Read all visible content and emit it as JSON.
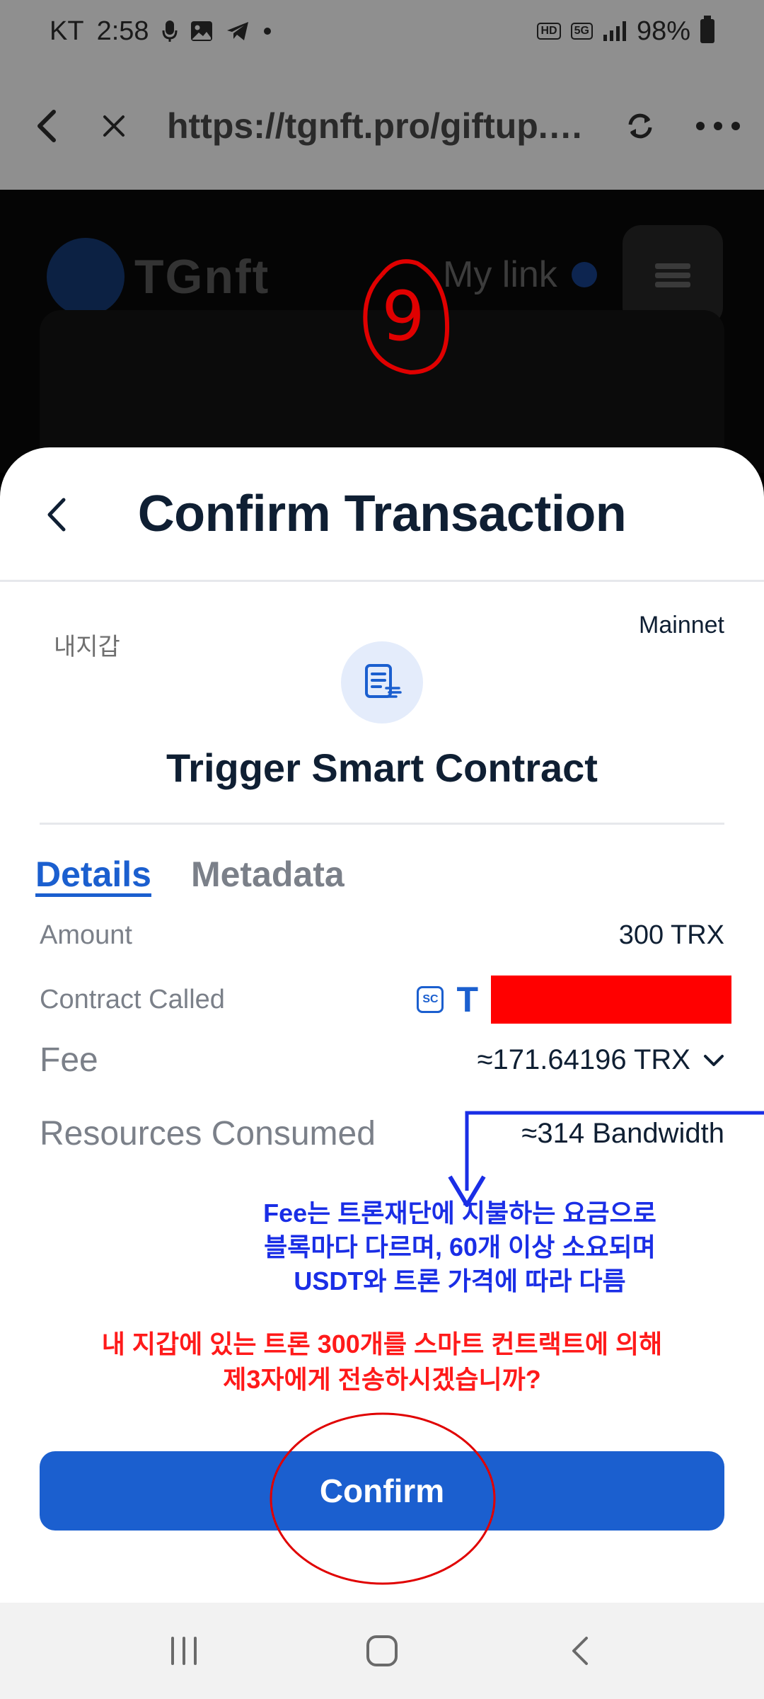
{
  "status_bar": {
    "carrier": "KT",
    "time": "2:58",
    "network_tag": "HD",
    "network_type": "5G",
    "battery": "98%"
  },
  "browser": {
    "url": "https://tgnft.pro/giftup.",
    "url_ellipsis": "…"
  },
  "webpage": {
    "logo_text": "TGnft",
    "my_link": "My link"
  },
  "annotations": {
    "step_number": "9",
    "blue_note": [
      "Fee는 트론재단에 지불하는 요금으로",
      "블록마다 다르며, 60개 이상 소요되며",
      "USDT와 트론 가격에 따라 다름"
    ],
    "red_note": [
      "내 지갑에 있는 트론 300개를 스마트 컨트랙트에 의해",
      "제3자에게 전송하시겠습니까?"
    ],
    "colors": {
      "blue": "#1a2ee6",
      "red": "#ff1a1a"
    }
  },
  "sheet": {
    "title": "Confirm Transaction",
    "wallet_label": "내지갑",
    "network": "Mainnet",
    "action_title": "Trigger Smart Contract",
    "tabs": [
      {
        "label": "Details",
        "active": true
      },
      {
        "label": "Metadata",
        "active": false
      }
    ],
    "details": {
      "amount_label": "Amount",
      "amount_value": "300 TRX",
      "contract_label": "Contract Called",
      "contract_badge": "SC",
      "contract_address_prefix": "T",
      "fee_label": "Fee",
      "fee_value": "≈171.64196 TRX",
      "resources_label": "Resources Consumed",
      "resources_value": "≈314 Bandwidth"
    },
    "confirm_label": "Confirm",
    "accent_color": "#1b5fcf"
  }
}
